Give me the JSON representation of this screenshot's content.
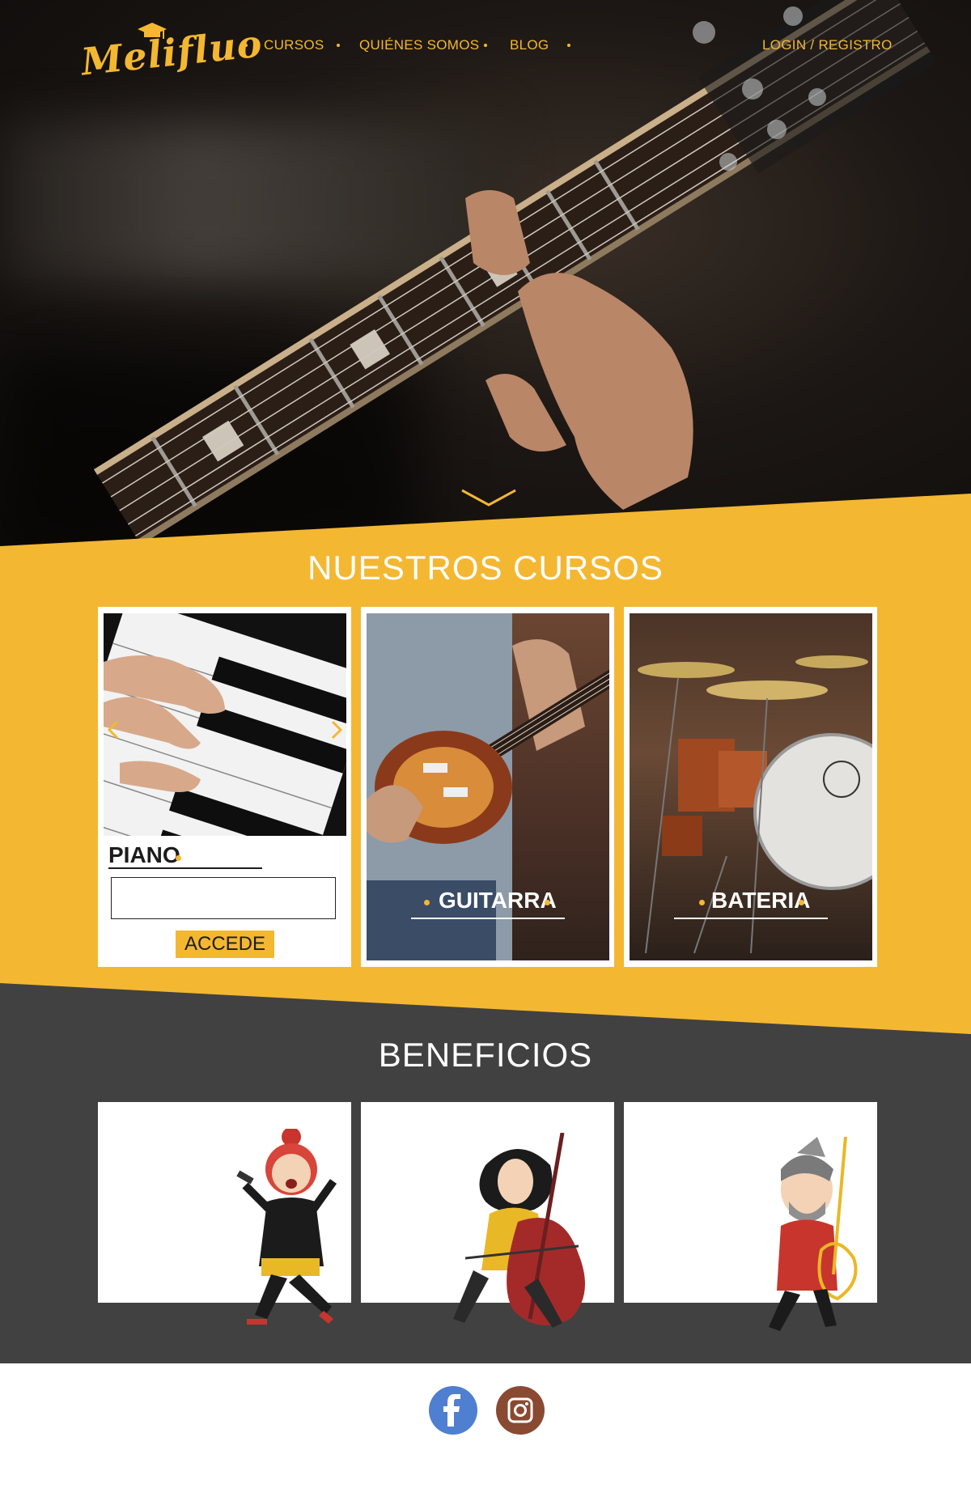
{
  "header": {
    "logo_text": "Melifluo",
    "nav": [
      {
        "label": "CURSOS"
      },
      {
        "label": "QUIÉNES SOMOS"
      },
      {
        "label": "BLOG"
      }
    ],
    "login_label": "LOGIN / REGISTRO"
  },
  "hero": {
    "scroll_icon": "chevron-down-icon"
  },
  "courses": {
    "title": "NUESTROS CURSOS",
    "cards": [
      {
        "label": "PIANO",
        "button_label": "ACCEDE",
        "input_value": ""
      },
      {
        "label": "GUITARRA"
      },
      {
        "label": "BATERIA"
      }
    ]
  },
  "benefits": {
    "title": "BENEFICIOS",
    "items": [
      {
        "illustration": "singer-illustration"
      },
      {
        "illustration": "cellist-illustration"
      },
      {
        "illustration": "guitarist-illustration"
      }
    ]
  },
  "footer": {
    "social": [
      {
        "icon": "facebook-icon",
        "color": "#4f7fd1"
      },
      {
        "icon": "instagram-icon",
        "color": "#8a4a31"
      }
    ]
  },
  "colors": {
    "accent": "#f4b731",
    "dark": "#414141"
  }
}
